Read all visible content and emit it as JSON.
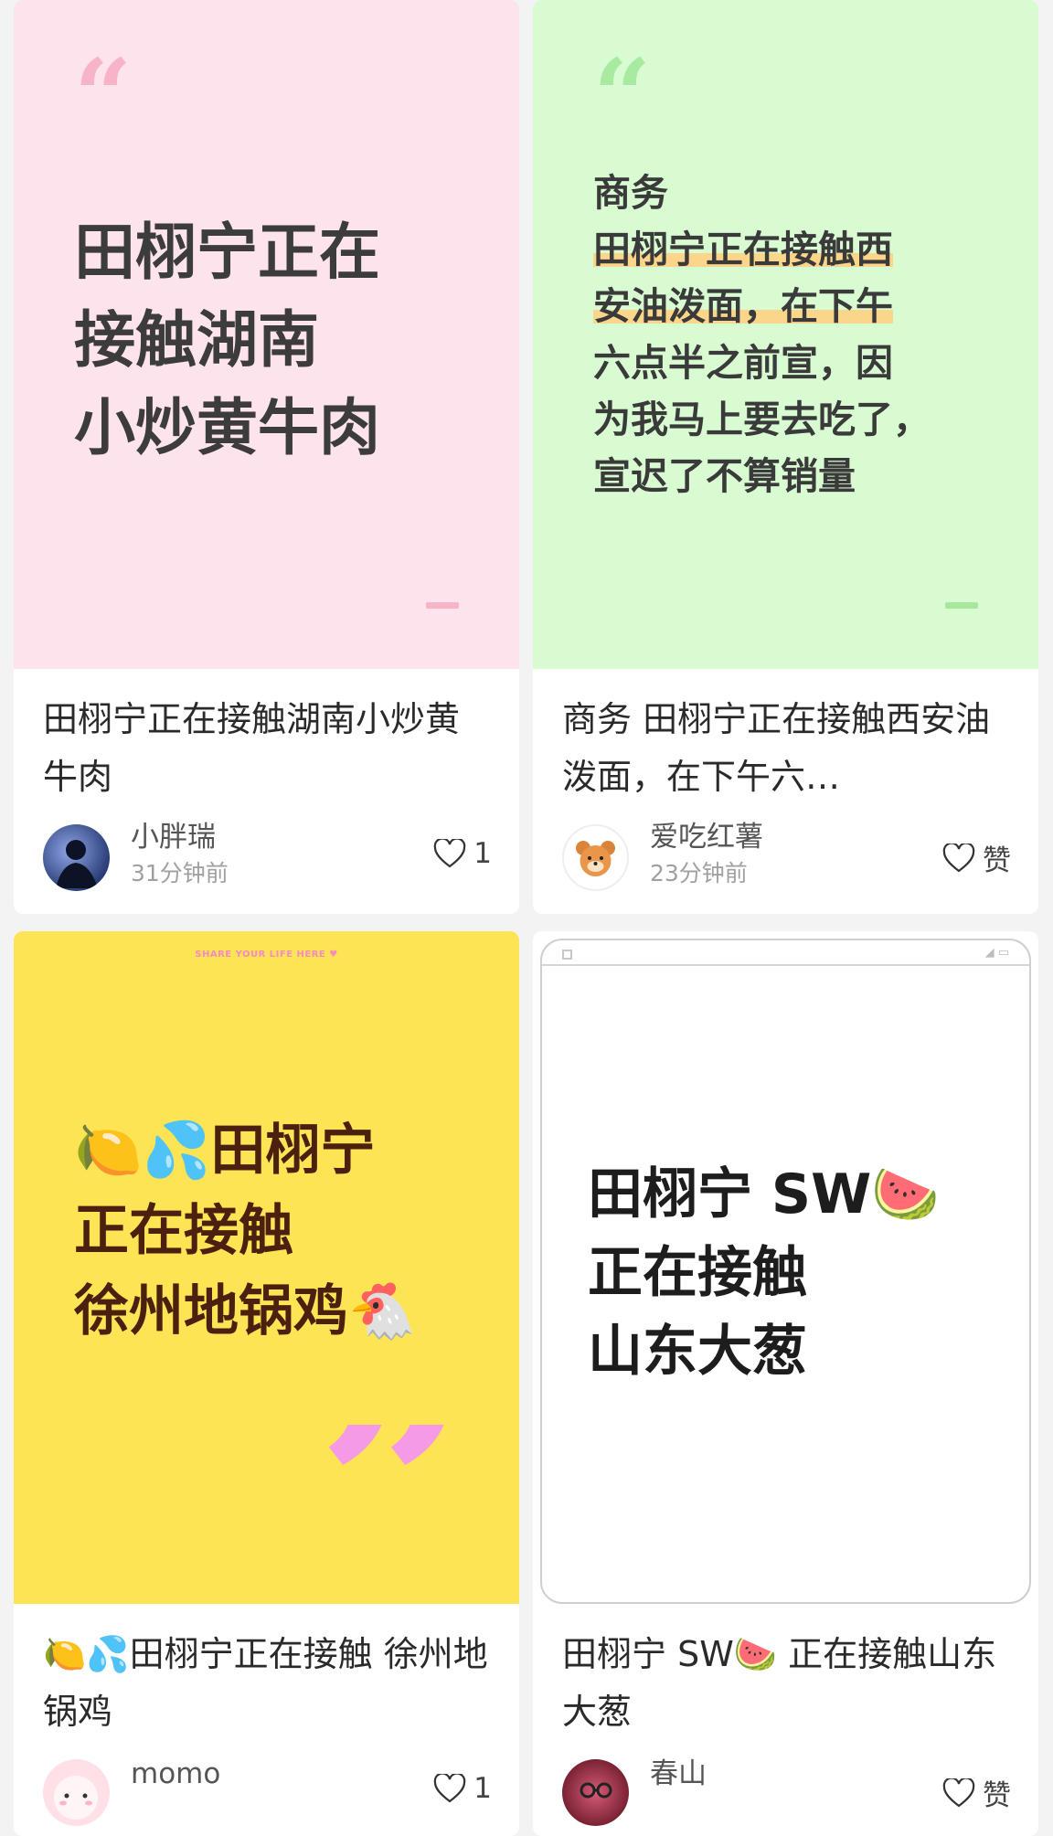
{
  "cards": [
    {
      "cover_text_lines": [
        "田栩宁正在",
        "接触湖南",
        "小炒黄牛肉"
      ],
      "title": "田栩宁正在接触湖南小炒黄牛肉",
      "user": "小胖瑞",
      "time": "31分钟前",
      "likes": "1"
    },
    {
      "cover_text_lines": [
        "商务",
        "田栩宁正在接触西",
        "安油泼面，在下午",
        "六点半之前宣，因",
        "为我马上要去吃了，",
        "宣迟了不算销量"
      ],
      "title": "商务 田栩宁正在接触西安油泼面，在下午六…",
      "user": "爱吃红薯",
      "time": "23分钟前",
      "likes": "赞"
    },
    {
      "cover_small": "SHARE YOUR LIFE HERE ♥",
      "cover_text_lines": [
        "🍋💦田栩宁",
        "正在接触",
        "徐州地锅鸡🐔"
      ],
      "title": "🍋💦田栩宁正在接触 徐州地锅鸡",
      "user": "momo",
      "time": "",
      "likes": "1"
    },
    {
      "cover_text_lines": [
        "田栩宁 SW🍉",
        "正在接触",
        "山东大葱"
      ],
      "title": "田栩宁 SW🍉 正在接触山东大葱",
      "user": "春山",
      "time": "",
      "likes": "赞"
    }
  ],
  "icons": {
    "heart": "heart-icon",
    "open_quote": "“",
    "close_quote": "”"
  }
}
